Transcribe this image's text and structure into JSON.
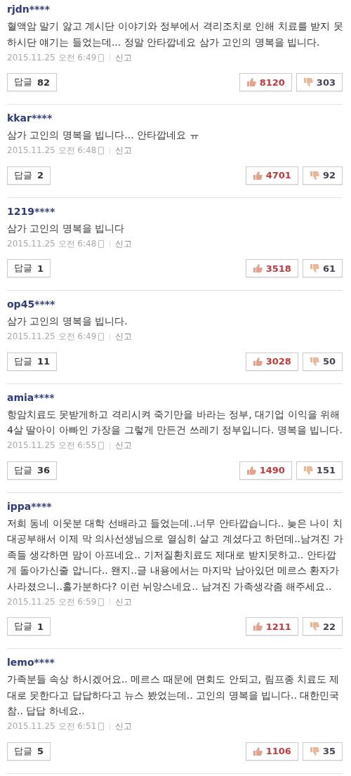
{
  "comments": [
    {
      "user": "rjdn****",
      "text": "혈액암 말기 앓고 계시단 이야기와 정부에서 격리조치로 인해 치료를 받지 못하시단 얘기는 들었는데... 정말 안타깝네요 삼가 고인의 명복을 빕니다.",
      "date": "2015.11.25 오전 6:49",
      "report": "신고",
      "reply_label": "답글",
      "replies": "82",
      "likes": "8120",
      "dislikes": "303"
    },
    {
      "user": "kkar****",
      "text": "삼가 고인의 명복을 빕니다... 안타깝네요 ㅠ",
      "date": "2015.11.25 오전 6:48",
      "report": "신고",
      "reply_label": "답글",
      "replies": "2",
      "likes": "4701",
      "dislikes": "92"
    },
    {
      "user": "1219****",
      "text": "삼가 고인의 명복을 빕니다",
      "date": "2015.11.25 오전 6:48",
      "report": "신고",
      "reply_label": "답글",
      "replies": "1",
      "likes": "3518",
      "dislikes": "61"
    },
    {
      "user": "op45****",
      "text": "삼가 고인의 명복을 빕니다.",
      "date": "2015.11.25 오전 6:49",
      "report": "신고",
      "reply_label": "답글",
      "replies": "11",
      "likes": "3028",
      "dislikes": "50"
    },
    {
      "user": "amia****",
      "text": "항암치료도 못받게하고 격리시켜 죽기만을 바라는 정부, 대기업 이익을 위해 4살 딸아이 아빠인 가장을 그렇게 만든건 쓰레기 정부입니다. 명복을 빕니다.",
      "date": "2015.11.25 오전 6:55",
      "report": "신고",
      "reply_label": "답글",
      "replies": "36",
      "likes": "1490",
      "dislikes": "151"
    },
    {
      "user": "ippa****",
      "text": "저희 동네 이웃분 대학 선배라고 들었는데..너무 안타깝습니다.. 늦은 나이 치대공부해서 이제 막 의사선생님으로 열심히 살고 계셨다고 하던데..남겨진 가족들 생각하면 맘이 아프네요.. 기저질환치료도 제대로 받지못하고.. 안타깝게 돌아가신줄 압니다.. 왠지..글 내용에서는 마지막 남아있던 메르스 환자가 사라졌으니..홀가분하다? 이런 뉘앙스네요.. 남겨진 가족생각좀 해주세요..",
      "date": "2015.11.25 오전 6:59",
      "report": "신고",
      "reply_label": "답글",
      "replies": "1",
      "likes": "1211",
      "dislikes": "22"
    },
    {
      "user": "lemo****",
      "text": "가족분들 속상 하시겠어요.. 메르스 때문에 면회도 안되고, 림프종 치료도 제대로 못한다고 답답하다고 뉴스 봤었는데.. 고인의 명복을 빕니다.. 대한민국 참.. 답답 하네요..",
      "date": "2015.11.25 오전 6:51",
      "report": "신고",
      "reply_label": "답글",
      "replies": "5",
      "likes": "1106",
      "dislikes": "35"
    }
  ]
}
